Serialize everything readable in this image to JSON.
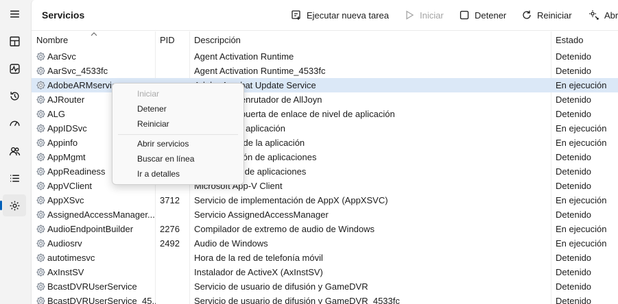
{
  "window": {
    "title": "Servicios"
  },
  "toolbar": {
    "new_task": "Ejecutar nueva tarea",
    "start": "Iniciar",
    "stop": "Detener",
    "restart": "Reiniciar",
    "open": "Abr"
  },
  "columns": {
    "name": "Nombre",
    "pid": "PID",
    "desc": "Descripción",
    "state": "Estado"
  },
  "rows": [
    {
      "name": "AarSvc",
      "pid": "",
      "desc": "Agent Activation Runtime",
      "state": "Detenido"
    },
    {
      "name": "AarSvc_4533fc",
      "pid": "",
      "desc": "Agent Activation Runtime_4533fc",
      "state": "Detenido"
    },
    {
      "name": "AdobeARMservice",
      "pid": "",
      "desc": "Adobe Acrobat Update Service",
      "state": "En ejecución",
      "selected": true
    },
    {
      "name": "AJRouter",
      "pid": "",
      "desc": "Servicio de enrutador de AllJoyn",
      "state": "Detenido"
    },
    {
      "name": "ALG",
      "pid": "",
      "desc": "Servicio de puerta de enlace de nivel de aplicación",
      "state": "Detenido"
    },
    {
      "name": "AppIDSvc",
      "pid": "",
      "desc": "Identidad de aplicación",
      "state": "En ejecución"
    },
    {
      "name": "Appinfo",
      "pid": "",
      "desc": "Información de la aplicación",
      "state": "En ejecución"
    },
    {
      "name": "AppMgmt",
      "pid": "",
      "desc": "Administración de aplicaciones",
      "state": "Detenido"
    },
    {
      "name": "AppReadiness",
      "pid": "",
      "desc": "Preparación de aplicaciones",
      "state": "Detenido"
    },
    {
      "name": "AppVClient",
      "pid": "",
      "desc": "Microsoft App-V Client",
      "state": "Detenido"
    },
    {
      "name": "AppXSvc",
      "pid": "3712",
      "desc": "Servicio de implementación de AppX (AppXSVC)",
      "state": "En ejecución"
    },
    {
      "name": "AssignedAccessManager...",
      "pid": "",
      "desc": "Servicio AssignedAccessManager",
      "state": "Detenido"
    },
    {
      "name": "AudioEndpointBuilder",
      "pid": "2276",
      "desc": "Compilador de extremo de audio de Windows",
      "state": "En ejecución"
    },
    {
      "name": "Audiosrv",
      "pid": "2492",
      "desc": "Audio de Windows",
      "state": "En ejecución"
    },
    {
      "name": "autotimesvc",
      "pid": "",
      "desc": "Hora de la red de telefonía móvil",
      "state": "Detenido"
    },
    {
      "name": "AxInstSV",
      "pid": "",
      "desc": "Instalador de ActiveX (AxInstSV)",
      "state": "Detenido"
    },
    {
      "name": "BcastDVRUserService",
      "pid": "",
      "desc": "Servicio de usuario de difusión y GameDVR",
      "state": "Detenido"
    },
    {
      "name": "BcastDVRUserService_45...",
      "pid": "",
      "desc": "Servicio de usuario de difusión y GameDVR_4533fc",
      "state": "Detenido"
    }
  ],
  "context_menu": {
    "start": "Iniciar",
    "stop": "Detener",
    "restart": "Reiniciar",
    "open_services": "Abrir servicios",
    "search_online": "Buscar en línea",
    "go_details": "Ir a detalles"
  },
  "colors": {
    "accent": "#005fb8",
    "selected_row": "#dbe8f7"
  }
}
